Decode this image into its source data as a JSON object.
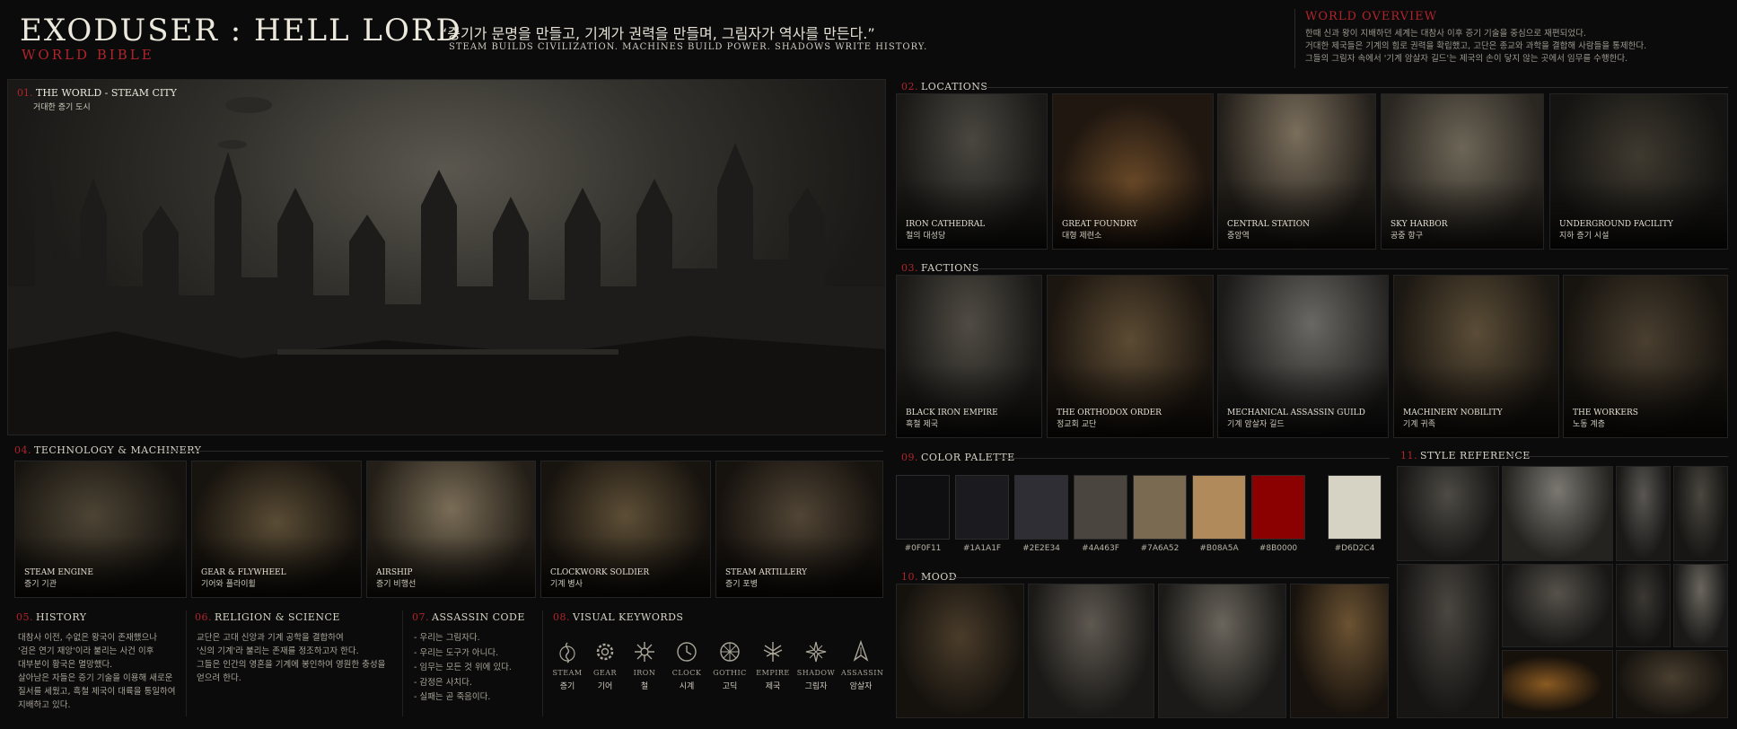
{
  "header": {
    "title": "EXODUSER : HELL LORD",
    "subtitle": "WORLD BIBLE",
    "quote_kr": "“증기가 문명을 만들고, 기계가 권력을 만들며, 그림자가 역사를 만든다.”",
    "quote_en": "STEAM BUILDS CIVILIZATION. MACHINES BUILD POWER. SHADOWS WRITE HISTORY."
  },
  "overview": {
    "title_first": "W",
    "title_rest": "ORLD OVERVIEW",
    "lines": [
      "한때 신과 왕이 지배하던 세계는 대참사 이후 증기 기술을 중심으로 재편되었다.",
      "거대한 제국들은 기계의 힘로 권력을 확립했고, 고단은 종교와 과학을 결합해 사람들을 통제한다.",
      "그들의 그림자 속에서 '기계 암살자 길드'는 제국의 손이 닿지 않는 곳에서 임무를 수행한다."
    ]
  },
  "world": {
    "num": "01.",
    "label": "THE WORLD - STEAM CITY",
    "sub": "거대한 증기 도시"
  },
  "locations": {
    "num": "02.",
    "label": "LOCATIONS",
    "items": [
      {
        "en": "IRON CATHEDRAL",
        "kr": "철의 대성당"
      },
      {
        "en": "GREAT FOUNDRY",
        "kr": "대형 제련소"
      },
      {
        "en": "CENTRAL STATION",
        "kr": "중앙역"
      },
      {
        "en": "SKY HARBOR",
        "kr": "공중 항구"
      },
      {
        "en": "UNDERGROUND FACILITY",
        "kr": "지하 증기 시설"
      }
    ]
  },
  "factions": {
    "num": "03.",
    "label": "FACTIONS",
    "items": [
      {
        "en": "BLACK IRON EMPIRE",
        "kr": "흑철 제국"
      },
      {
        "en": "THE ORTHODOX ORDER",
        "kr": "정교회 교단"
      },
      {
        "en": "MECHANICAL ASSASSIN GUILD",
        "kr": "기계 암살자 길드"
      },
      {
        "en": "MACHINERY NOBILITY",
        "kr": "기계 귀족"
      },
      {
        "en": "THE WORKERS",
        "kr": "노동 계층"
      }
    ]
  },
  "technology": {
    "num": "04.",
    "label": "TECHNOLOGY & MACHINERY",
    "items": [
      {
        "en": "STEAM ENGINE",
        "kr": "증기 기관"
      },
      {
        "en": "GEAR & FLYWHEEL",
        "kr": "기어와 플라이휠"
      },
      {
        "en": "AIRSHIP",
        "kr": "증기 비행선"
      },
      {
        "en": "CLOCKWORK SOLDIER",
        "kr": "기계 병사"
      },
      {
        "en": "STEAM ARTILLERY",
        "kr": "증기 포병"
      }
    ]
  },
  "history": {
    "num": "05.",
    "label": "HISTORY",
    "lines": [
      "대참사 이전, 수없은 왕국이 존재했으나",
      "'검은 연기 재앙'이라 불리는 사건 이후",
      "대부분이 황국은 멸망했다.",
      "살아남은 자들은 증기 기술을 이용해 새로운",
      "질서를 세웠고, 흑철 제국이 대륙을 통일하여",
      "지배하고 있다."
    ]
  },
  "religion": {
    "num": "06.",
    "label": "RELIGION & SCIENCE",
    "lines": [
      "교단은 고대 신앙과 기계 공학을 결합하여",
      "'신의 기계'라 불리는 존재를 정조하고자 한다.",
      "그들은 인간의 영혼을 기계에 봉인하여 영원한 충성을",
      "얻으려 한다."
    ]
  },
  "code": {
    "num": "07.",
    "label": "ASSASSIN CODE",
    "lines": [
      "- 우리는 그림자다.",
      "- 우리는 도구가 아니다.",
      "- 임무는 모든 것 위에 있다.",
      "- 감정은 사치다.",
      "- 실패는 곧 죽음이다."
    ]
  },
  "keywords": {
    "num": "08.",
    "label": "VISUAL KEYWORDS",
    "items": [
      {
        "icon": "steam-icon",
        "en": "STEAM",
        "kr": "증기"
      },
      {
        "icon": "gear-icon",
        "en": "GEAR",
        "kr": "기어"
      },
      {
        "icon": "iron-icon",
        "en": "IRON",
        "kr": "철"
      },
      {
        "icon": "clock-icon",
        "en": "CLOCK",
        "kr": "시계"
      },
      {
        "icon": "gothic-icon",
        "en": "GOTHIC",
        "kr": "고딕"
      },
      {
        "icon": "empire-icon",
        "en": "EMPIRE",
        "kr": "제국"
      },
      {
        "icon": "shadow-icon",
        "en": "SHADOW",
        "kr": "그림자"
      },
      {
        "icon": "assassin-icon",
        "en": "ASSASSIN",
        "kr": "암살자"
      }
    ]
  },
  "palette": {
    "num": "09.",
    "label": "COLOR PALETTE",
    "colors": [
      "#0F0F11",
      "#1A1A1F",
      "#2E2E34",
      "#4A463F",
      "#7A6A52",
      "#B08A5A",
      "#8B0000",
      "#D6D2C4"
    ]
  },
  "mood": {
    "num": "10.",
    "label": "MOOD"
  },
  "style": {
    "num": "11.",
    "label": "STYLE REFERENCE"
  }
}
